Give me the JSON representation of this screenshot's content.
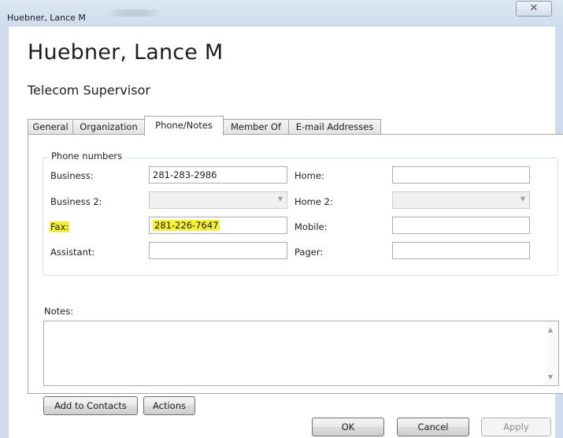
{
  "window": {
    "title": "Huebner, Lance M",
    "close_glyph": "✕"
  },
  "contact": {
    "name": "Huebner, Lance M",
    "job_title": "Telecom Supervisor"
  },
  "tabs": [
    {
      "label": "General",
      "active": false
    },
    {
      "label": "Organization",
      "active": false
    },
    {
      "label": "Phone/Notes",
      "active": true
    },
    {
      "label": "Member Of",
      "active": false
    },
    {
      "label": "E-mail Addresses",
      "active": false
    }
  ],
  "phone_numbers": {
    "group_title": "Phone numbers",
    "business": {
      "label": "Business:",
      "value": "281-283-2986"
    },
    "business2": {
      "label": "Business 2:",
      "value": ""
    },
    "fax": {
      "label": "Fax:",
      "value": "281-226-7647"
    },
    "assistant": {
      "label": "Assistant:",
      "value": ""
    },
    "home": {
      "label": "Home:",
      "value": ""
    },
    "home2": {
      "label": "Home 2:",
      "value": ""
    },
    "mobile": {
      "label": "Mobile:",
      "value": ""
    },
    "pager": {
      "label": "Pager:",
      "value": ""
    }
  },
  "notes": {
    "label": "Notes:",
    "value": ""
  },
  "buttons": {
    "add_to_contacts": "Add to Contacts",
    "actions": "Actions",
    "ok": "OK",
    "cancel": "Cancel",
    "apply": "Apply"
  },
  "colors": {
    "highlight": "#f5f038",
    "titlebar": "#cfdcec"
  },
  "icons": {
    "close": "close-icon",
    "dropdown": "chevron-down-icon",
    "scroll_up": "scroll-up-icon",
    "scroll_down": "scroll-down-icon"
  }
}
